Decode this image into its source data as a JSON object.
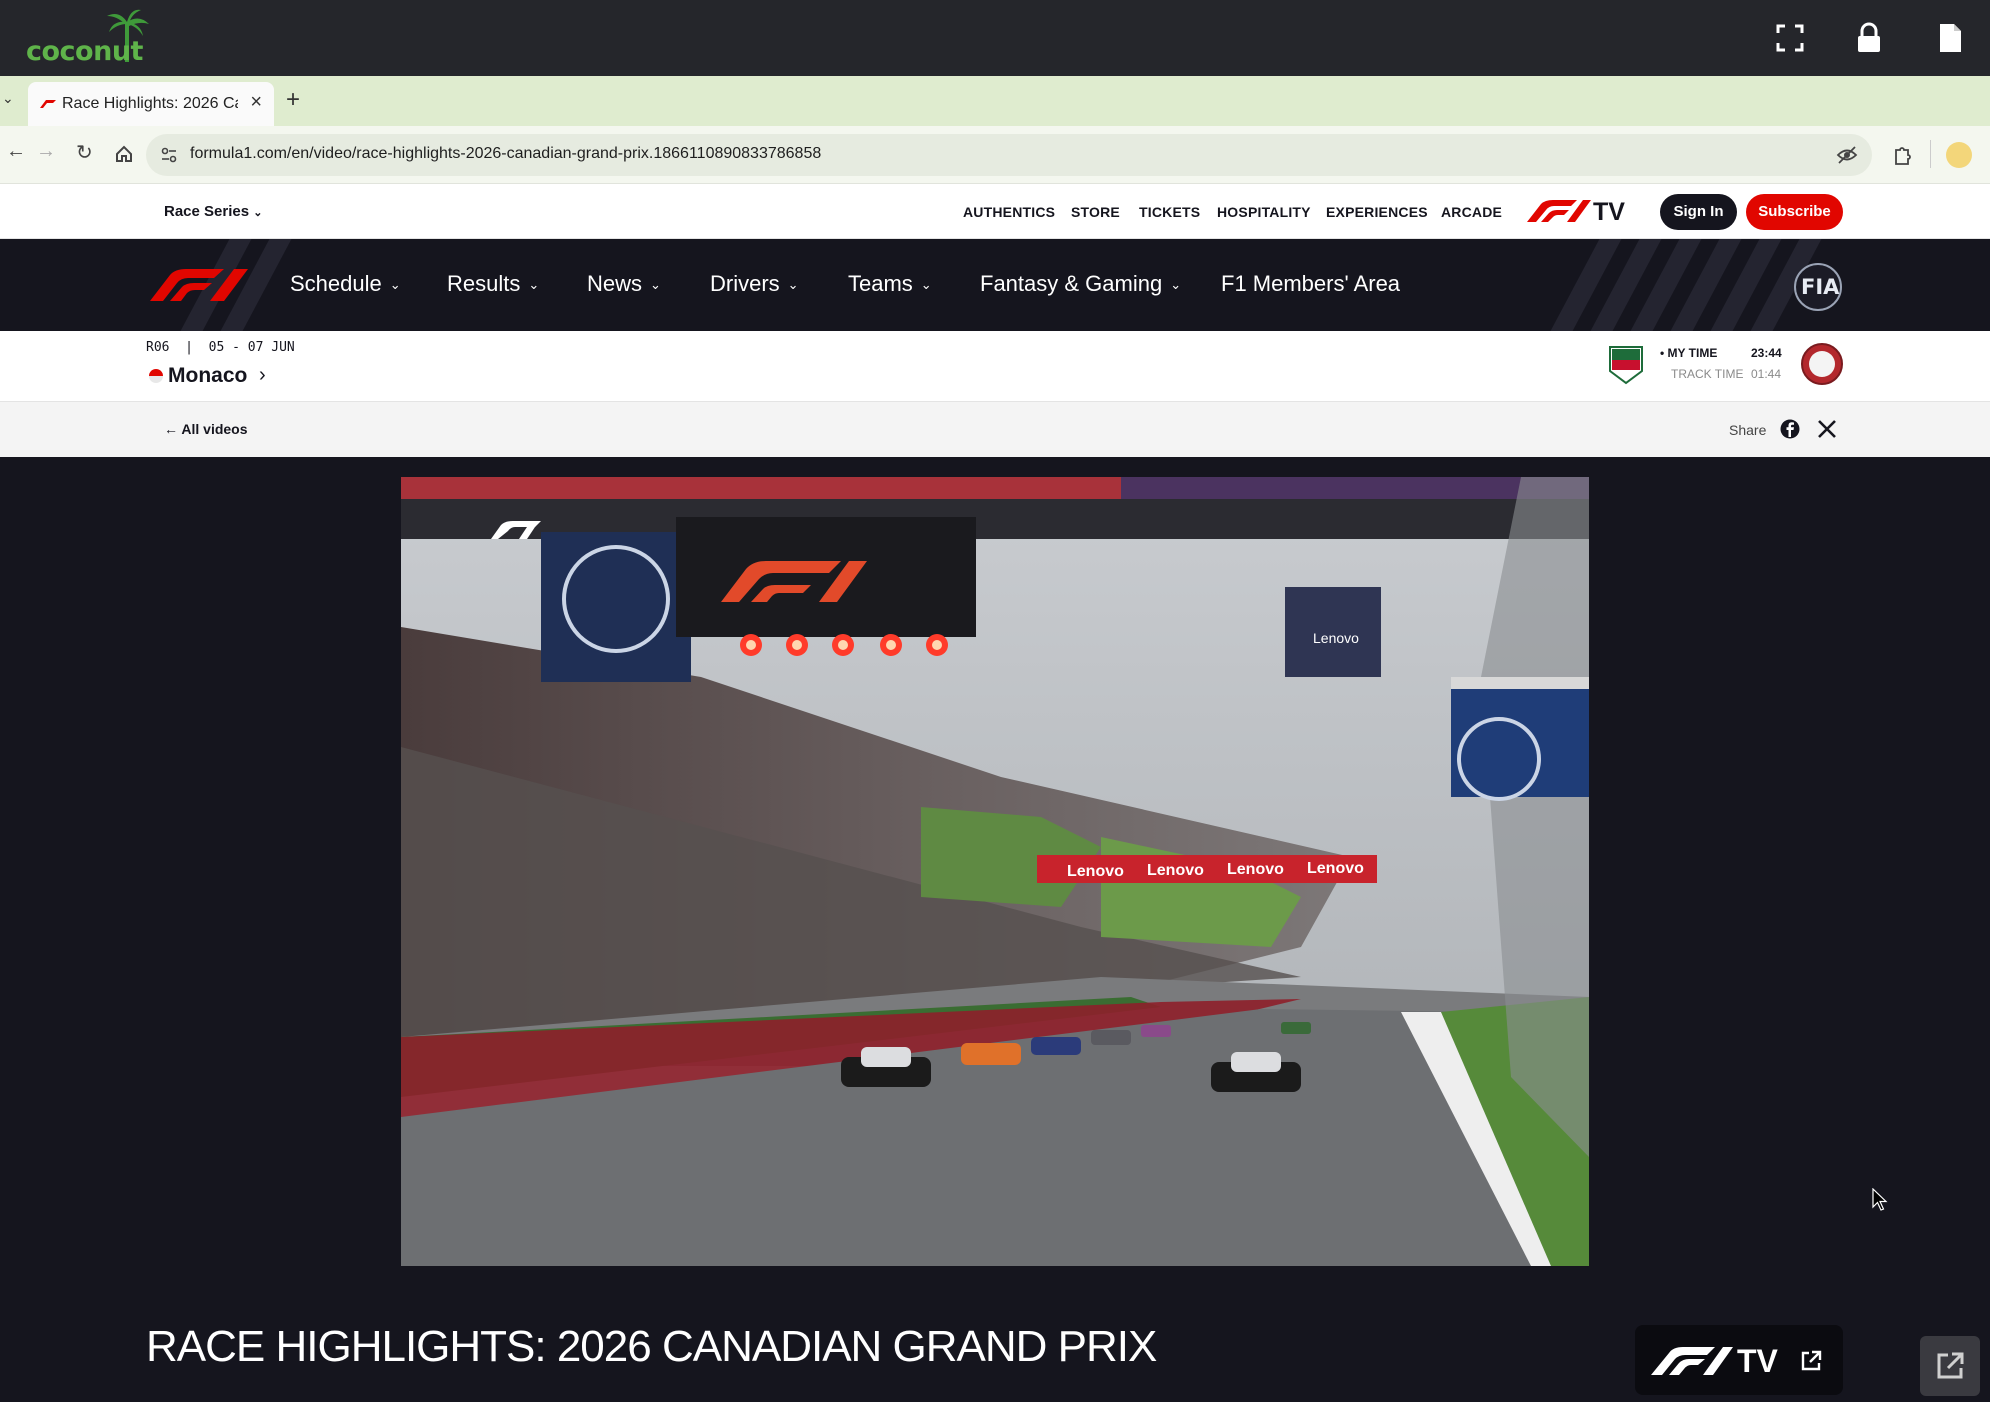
{
  "os": {
    "brand": "coconut"
  },
  "browser": {
    "tab_title": "Race Highlights: 2026 Ca",
    "tab_close": "×",
    "new_tab": "+",
    "url": "formula1.com/en/video/race-highlights-2026-canadian-grand-prix.1866110890833786858"
  },
  "utility_nav": {
    "race_series": "Race Series",
    "links": [
      "AUTHENTICS",
      "STORE",
      "TICKETS",
      "HOSPITALITY",
      "EXPERIENCES",
      "ARCADE"
    ],
    "f1tv": "TV",
    "sign_in": "Sign In",
    "subscribe": "Subscribe"
  },
  "main_nav": {
    "items": [
      "Schedule",
      "Results",
      "News",
      "Drivers",
      "Teams",
      "Fantasy & Gaming"
    ],
    "members": "F1 Members' Area",
    "fia": "FIA"
  },
  "race": {
    "round": "R06",
    "dates": "05 - 07 JUN",
    "gp_name": "Monaco",
    "sponsor": "TAG HEUER",
    "my_time_label": "MY TIME",
    "my_time": "23:44",
    "track_time_label": "TRACK TIME",
    "track_time": "01:44"
  },
  "subnav": {
    "back": "All videos",
    "share": "Share"
  },
  "video": {
    "banner_text": "Lenovo",
    "overlay_logo": "F1"
  },
  "title": "RACE HIGHLIGHTS: 2026 CANADIAN GRAND PRIX",
  "f1tv_button": "TV",
  "colors": {
    "f1_red": "#e10600",
    "dark": "#15151e",
    "tab_bar": "#dfeccf"
  }
}
